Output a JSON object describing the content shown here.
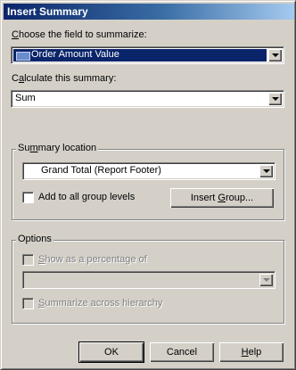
{
  "dialog": {
    "title": "Insert Summary"
  },
  "field": {
    "label_pre": "",
    "label_key": "C",
    "label_post": "hoose the field to summarize:",
    "value": "Order Amount Value"
  },
  "calc": {
    "label_pre": "C",
    "label_key": "a",
    "label_post": "lculate this summary:",
    "value": "Sum"
  },
  "location": {
    "title_pre": "Su",
    "title_key": "m",
    "title_post": "mary location",
    "value": "Grand Total (Report Footer)",
    "add_all_pre": "Add to all group levels",
    "insert_group_pre": "Insert ",
    "insert_group_key": "G",
    "insert_group_post": "roup..."
  },
  "options": {
    "title": "Options",
    "show_pct_pre": "",
    "show_pct_key": "S",
    "show_pct_post": "how as a percentage of",
    "pct_value": "",
    "summarize_pre": "",
    "summarize_key": "S",
    "summarize_post": "ummarize across hierarchy"
  },
  "buttons": {
    "ok": "OK",
    "cancel": "Cancel",
    "help_pre": "",
    "help_key": "H",
    "help_post": "elp"
  }
}
